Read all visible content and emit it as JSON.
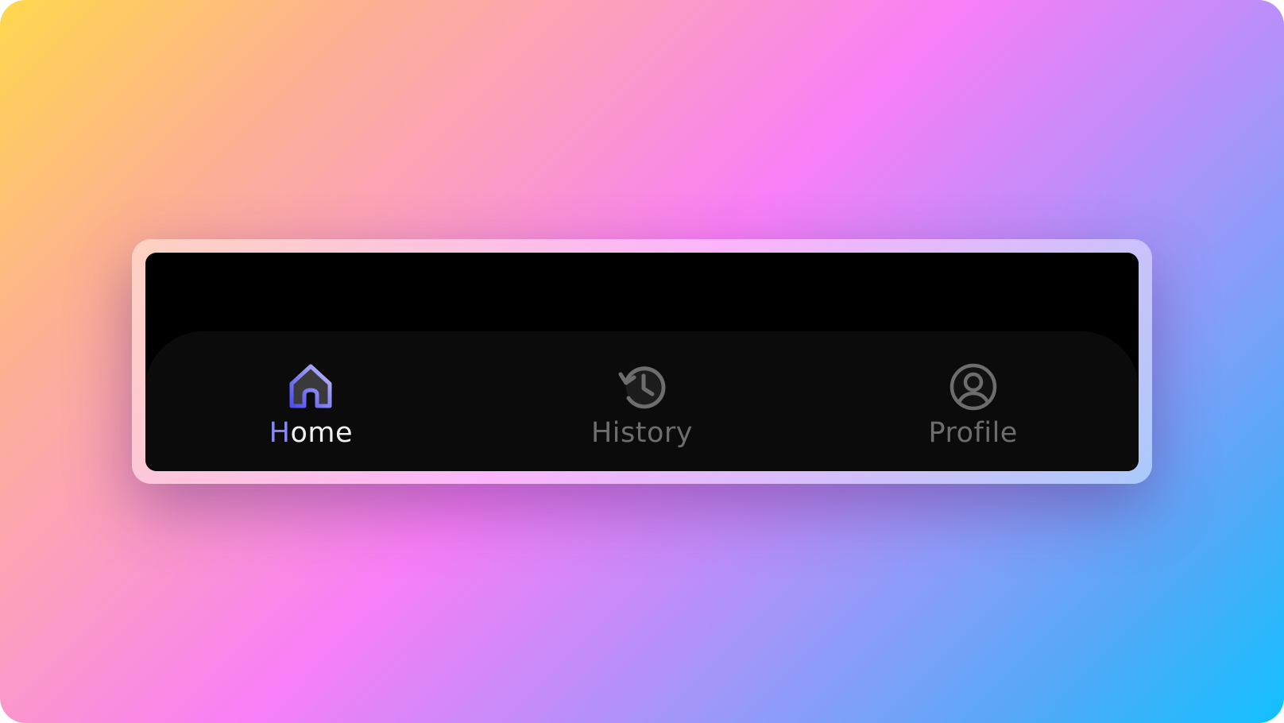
{
  "navigation": {
    "tabs": [
      {
        "label_first": "H",
        "label_rest": "ome",
        "icon": "home-icon",
        "active": true
      },
      {
        "label": "History",
        "icon": "history-icon",
        "active": false
      },
      {
        "label": "Profile",
        "icon": "profile-icon",
        "active": false
      }
    ]
  },
  "colors": {
    "active_gradient_start": "#5b5cf0",
    "active_gradient_end": "#b7b3f7",
    "inactive": "#6d6d6d",
    "tabbar_bg": "#0b0b0b",
    "screen_bg": "#000000"
  }
}
